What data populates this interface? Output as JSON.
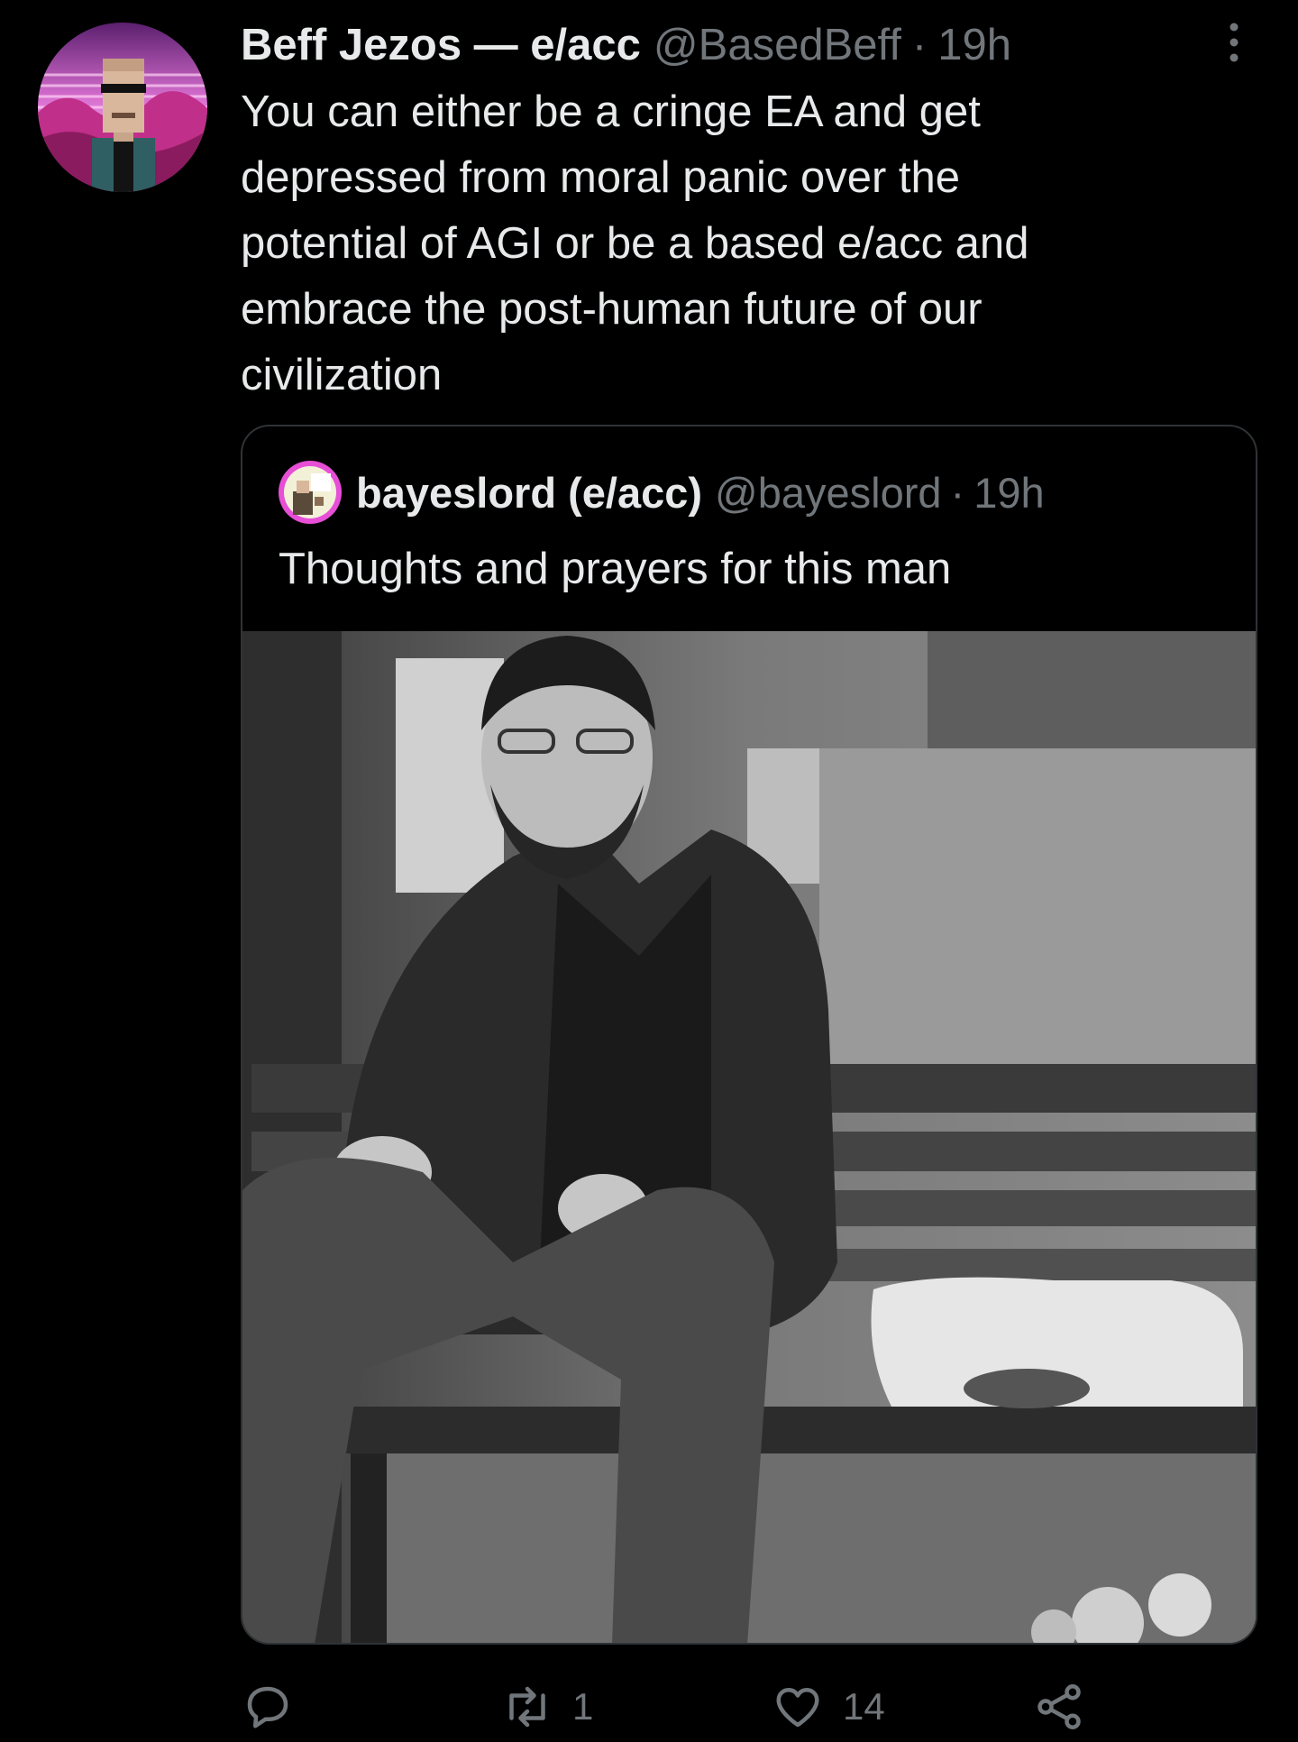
{
  "tweet": {
    "display_name": "Beff Jezos — e/acc",
    "handle": "@BasedBeff",
    "separator": "·",
    "time": "19h",
    "text_lines": [
      "You can either be a cringe EA and get",
      "depressed from moral panic over the",
      "potential of AGI or be a based e/acc and",
      "embrace the post-human future of our",
      "civilization"
    ]
  },
  "quote": {
    "display_name": "bayeslord (e/acc)",
    "handle": "@bayeslord",
    "separator": "·",
    "time": "19h",
    "text": "Thoughts and prayers for this man"
  },
  "actions": {
    "reply_icon": "reply-icon",
    "retweet_icon": "retweet-icon",
    "retweet_count": "1",
    "like_icon": "heart-icon",
    "like_count": "14",
    "share_icon": "share-icon"
  },
  "colors": {
    "background": "#000000",
    "text_primary": "#e7e9ea",
    "text_secondary": "#71767b",
    "border": "#2f3336",
    "avatar_accent": "#b43aa8"
  }
}
